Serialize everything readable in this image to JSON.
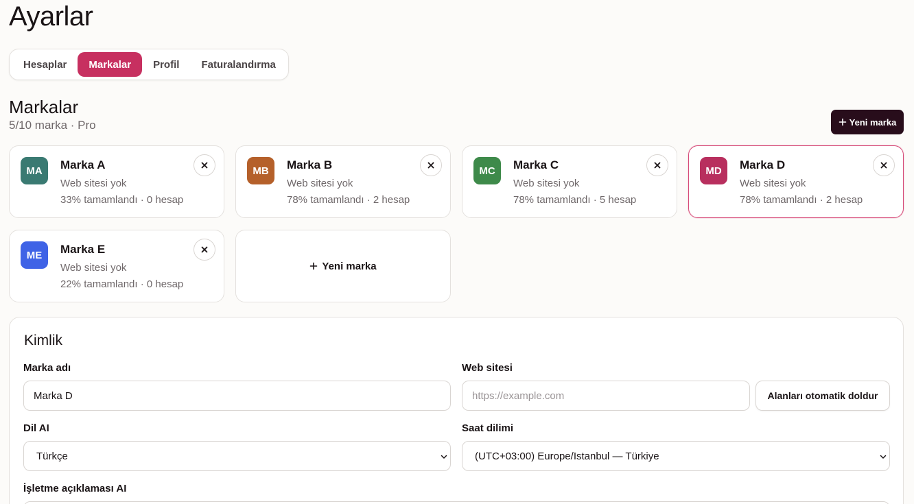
{
  "page": {
    "title": "Ayarlar"
  },
  "tabs": [
    {
      "label": "Hesaplar",
      "active": false
    },
    {
      "label": "Markalar",
      "active": true
    },
    {
      "label": "Profil",
      "active": false
    },
    {
      "label": "Faturalandırma",
      "active": false
    }
  ],
  "brands_section": {
    "title": "Markalar",
    "subtitle": "5/10 marka · Pro",
    "new_button_label": "Yeni marka",
    "add_card_label": "Yeni marka"
  },
  "brands": [
    {
      "initials": "MA",
      "name": "Marka A",
      "website": "Web sitesi yok",
      "meta": "33% tamamlandı · 0 hesap",
      "color": "#3a7a72",
      "selected": false
    },
    {
      "initials": "MB",
      "name": "Marka B",
      "website": "Web sitesi yok",
      "meta": "78% tamamlandı · 2 hesap",
      "color": "#b5602a",
      "selected": false
    },
    {
      "initials": "MC",
      "name": "Marka C",
      "website": "Web sitesi yok",
      "meta": "78% tamamlandı · 5 hesap",
      "color": "#3e8a4a",
      "selected": false
    },
    {
      "initials": "MD",
      "name": "Marka D",
      "website": "Web sitesi yok",
      "meta": "78% tamamlandı · 2 hesap",
      "color": "#b82f5e",
      "selected": true
    },
    {
      "initials": "ME",
      "name": "Marka E",
      "website": "Web sitesi yok",
      "meta": "22% tamamlandı · 0 hesap",
      "color": "#3f63e6",
      "selected": false
    }
  ],
  "identity": {
    "title": "Kimlik",
    "brand_name_label": "Marka adı",
    "brand_name_value": "Marka D",
    "website_label": "Web sitesi",
    "website_placeholder": "https://example.com",
    "autofill_label": "Alanları otomatik doldur",
    "language_label": "Dil AI",
    "language_value": "Türkçe",
    "timezone_label": "Saat dilimi",
    "timezone_value": "(UTC+03:00) Europe/Istanbul — Türkiye",
    "description_label": "İşletme açıklaması AI"
  },
  "colors": {
    "accent": "#c73060",
    "dark_button": "#280d1b"
  }
}
